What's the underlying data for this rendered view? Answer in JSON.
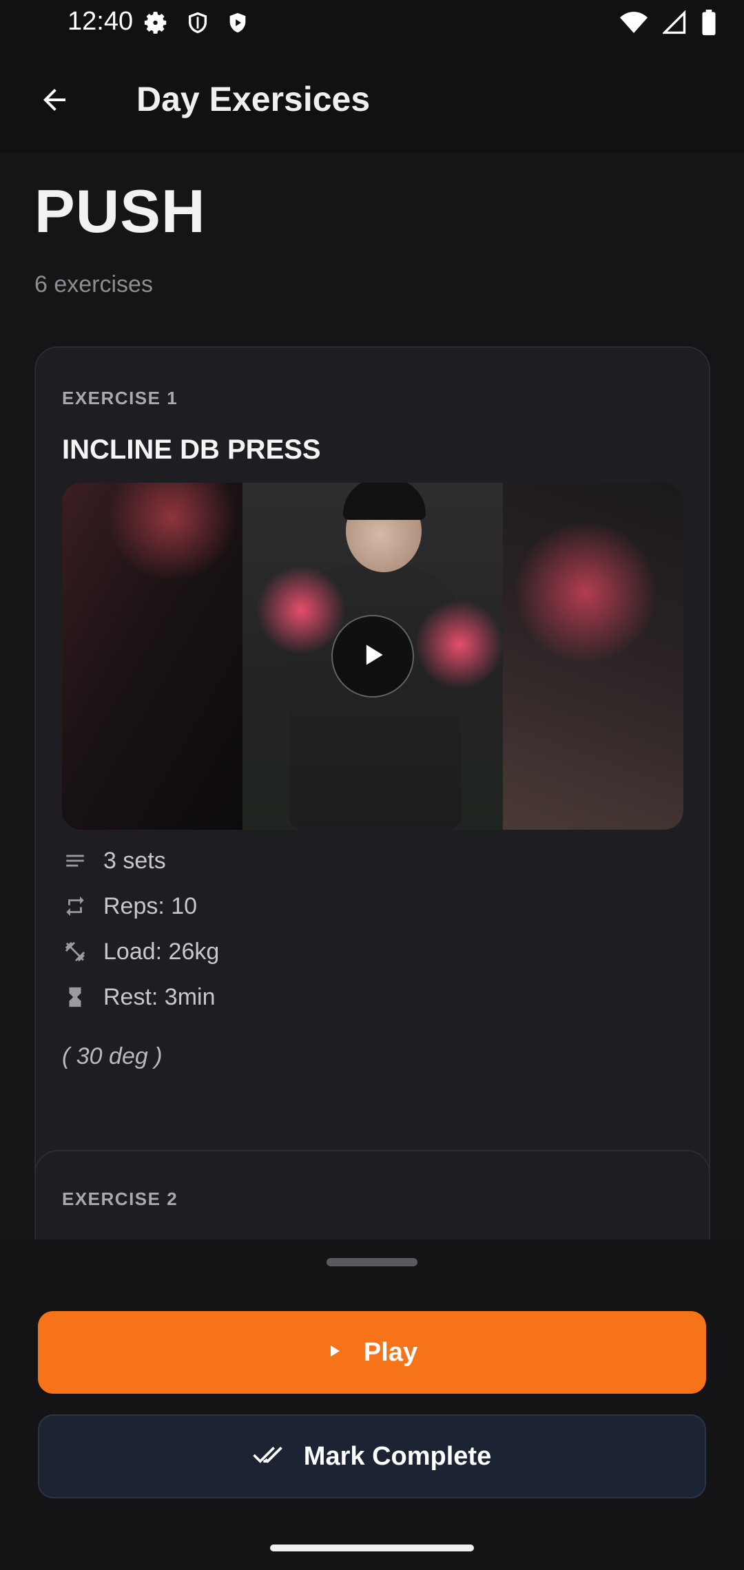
{
  "status_bar": {
    "time": "12:40",
    "left_icons": [
      "settings-icon",
      "shield-icon",
      "play-protect-icon"
    ],
    "right_icons": [
      "wifi-icon",
      "signal-icon",
      "battery-icon"
    ]
  },
  "app_bar": {
    "back_icon": "arrow-back-icon",
    "title": "Day Exersices"
  },
  "day": {
    "name": "PUSH",
    "exercise_count": "6 exercises"
  },
  "exercises": [
    {
      "label": "EXERCISE 1",
      "name": "INCLINE DB PRESS",
      "video_play_icon": "play-icon",
      "stats": [
        {
          "icon": "sets-icon",
          "text": "3 sets"
        },
        {
          "icon": "repeat-icon",
          "text": "Reps: 10"
        },
        {
          "icon": "dumbbell-icon",
          "text": "Load: 26kg"
        },
        {
          "icon": "hourglass-icon",
          "text": "Rest: 3min"
        }
      ],
      "note": "( 30 deg )"
    },
    {
      "label": "EXERCISE 2"
    }
  ],
  "actions": {
    "play_label": "Play",
    "complete_label": "Mark Complete"
  },
  "colors": {
    "accent": "#f77319",
    "secondary_button": "#1c2433",
    "card_bg": "#1e1e22",
    "background": "#141416"
  }
}
